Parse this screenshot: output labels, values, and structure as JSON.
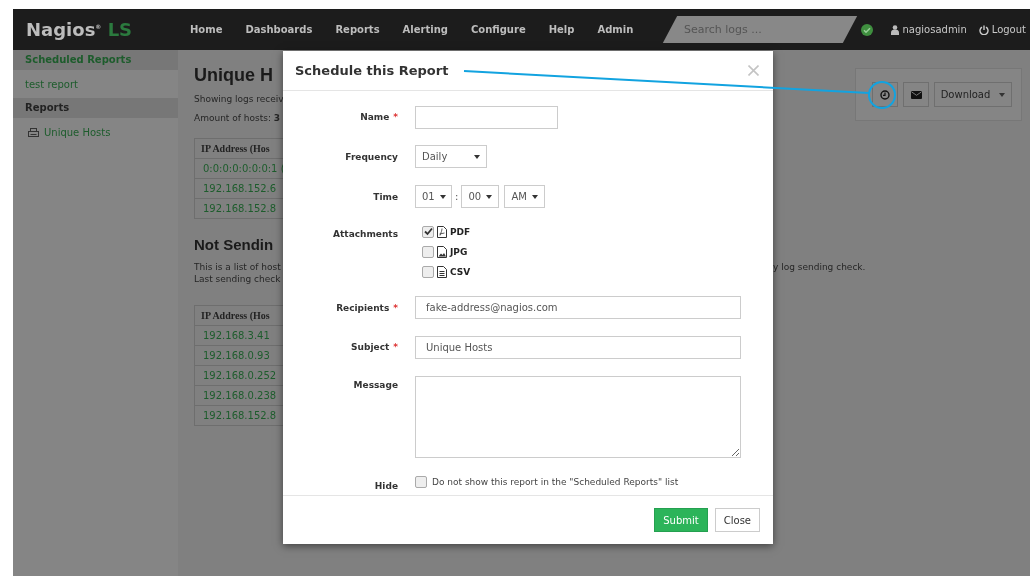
{
  "navbar": {
    "logo": "Nagios$^{®}$",
    "logo_suffix": "LS",
    "menu": [
      "Home",
      "Dashboards",
      "Reports",
      "Alerting",
      "Configure",
      "Help",
      "Admin"
    ],
    "search": {
      "placeholder": "Search logs ..."
    },
    "user": "nagiosadmin",
    "logout": "Logout"
  },
  "sidebar": {
    "items": [
      {
        "kind": "header-link",
        "label": "Scheduled Reports"
      },
      {
        "kind": "link",
        "label": "test report"
      },
      {
        "kind": "header",
        "label": "Reports"
      },
      {
        "kind": "report-link",
        "label": "Unique Hosts"
      }
    ]
  },
  "report": {
    "title": "Unique H",
    "lines": [
      "Showing logs receiv",
      "Amount of hosts: **3**"
    ],
    "table": {
      "column_1": "IP Address (Hos",
      "rows": [
        "0:0:0:0:0:0:0:1 (",
        "192.168.152.6",
        "192.168.152.8"
      ]
    },
    "section_title": "Not Sendin",
    "description": [
      "This is a list of host",
      "Last sending check"
    ],
    "description_tail": "y log sending check.",
    "table_2": {
      "column_1": "IP Address (Hos",
      "rows": [
        "192.168.3.41",
        "192.168.0.93",
        "192.168.0.252",
        "192.168.0.238",
        "192.168.152.8"
      ]
    },
    "toolbar": {
      "download": "Download"
    }
  },
  "modal": {
    "title": "Schedule this Report",
    "required_mark": "*",
    "fields": [
      {
        "kind": "text",
        "label": "Name",
        "required": true
      },
      {
        "kind": "select",
        "label": "Frequency",
        "required": false,
        "value": "Daily"
      },
      {
        "kind": "time",
        "label": "Time",
        "required": false,
        "hour": "01",
        "separator": ":",
        "minute": "00",
        "period": "AM"
      },
      {
        "kind": "checkboxes",
        "label": "Attachments",
        "required": false,
        "options": [
          {
            "label": "PDF",
            "checked": true
          },
          {
            "label": "JPG",
            "checked": false
          },
          {
            "label": "CSV",
            "checked": false
          }
        ]
      },
      {
        "kind": "wide-text",
        "label": "Recipients",
        "required": true,
        "value": "fake-address@nagios.com"
      },
      {
        "kind": "wide-text",
        "label": "Subject",
        "required": true,
        "value": "Unique Hosts"
      },
      {
        "kind": "textarea",
        "label": "Message",
        "required": false
      },
      {
        "kind": "checkbox",
        "label": "Hide",
        "required": false,
        "text": "Do not show this report in the \"Scheduled Reports\" list",
        "checked": false
      }
    ],
    "buttons": [
      "Submit",
      "Close"
    ]
  }
}
